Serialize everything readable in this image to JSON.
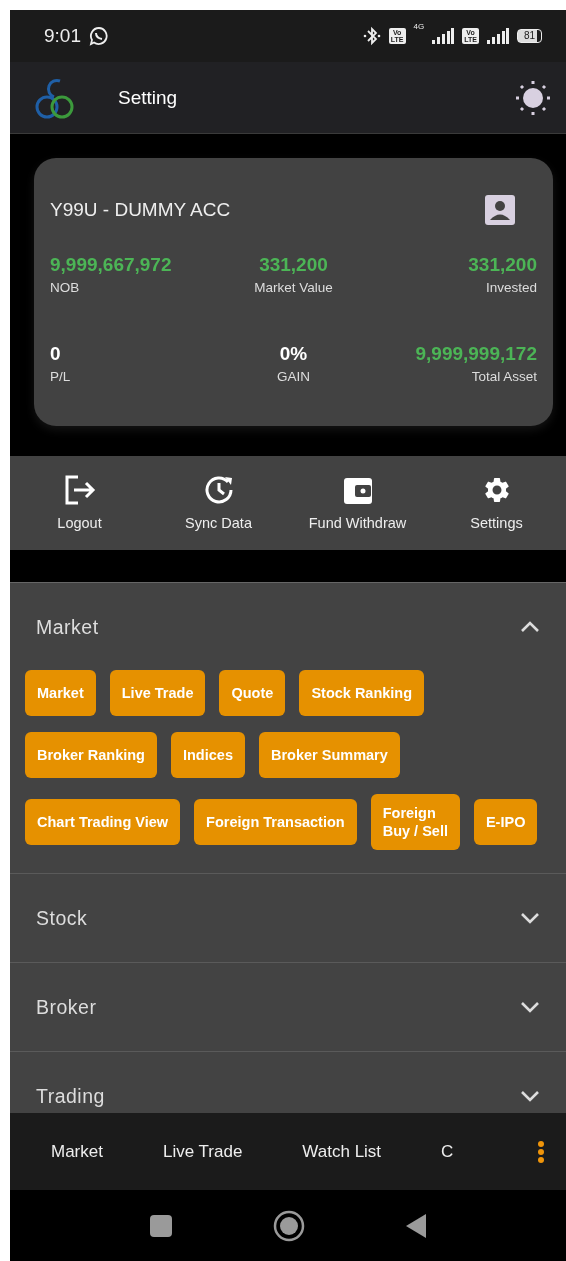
{
  "status_bar": {
    "time": "9:01",
    "sims": [
      {
        "badge_top": "Vo",
        "badge_bottom": "LTE",
        "network": "4G"
      },
      {
        "badge_top": "Vo",
        "badge_bottom": "LTE"
      }
    ],
    "battery": "81"
  },
  "app_bar": {
    "title": "Setting"
  },
  "account": {
    "name": "Y99U - DUMMY ACC",
    "stats": [
      {
        "value": "9,999,667,972",
        "label": "NOB",
        "positive": true
      },
      {
        "value": "331,200",
        "label": "Market Value",
        "positive": true
      },
      {
        "value": "331,200",
        "label": "Invested",
        "positive": true
      },
      {
        "value": "0",
        "label": "P/L",
        "positive": false
      },
      {
        "value": "0%",
        "label": "GAIN",
        "positive": false
      },
      {
        "value": "9,999,999,172",
        "label": "Total Asset",
        "positive": true
      }
    ]
  },
  "actions": [
    {
      "kind": "logout",
      "label": "Logout"
    },
    {
      "kind": "sync",
      "label": "Sync Data"
    },
    {
      "kind": "withdraw",
      "label": "Fund Withdraw"
    },
    {
      "kind": "settings",
      "label": "Settings"
    }
  ],
  "sections": [
    {
      "title": "Market",
      "expanded": true,
      "rows": [
        [
          "Market",
          "Live Trade",
          "Quote",
          "Stock Ranking"
        ],
        [
          "Broker Ranking",
          "Indices",
          "Broker Summary"
        ],
        [
          "Chart Trading View",
          "Foreign Transaction",
          [
            "Foreign",
            "Buy / Sell"
          ],
          "E-IPO"
        ]
      ]
    },
    {
      "title": "Stock",
      "expanded": false
    },
    {
      "title": "Broker",
      "expanded": false
    },
    {
      "title": "Trading",
      "expanded": false
    }
  ],
  "bottom_nav": [
    "Market",
    "Live Trade",
    "Watch List",
    "C"
  ]
}
